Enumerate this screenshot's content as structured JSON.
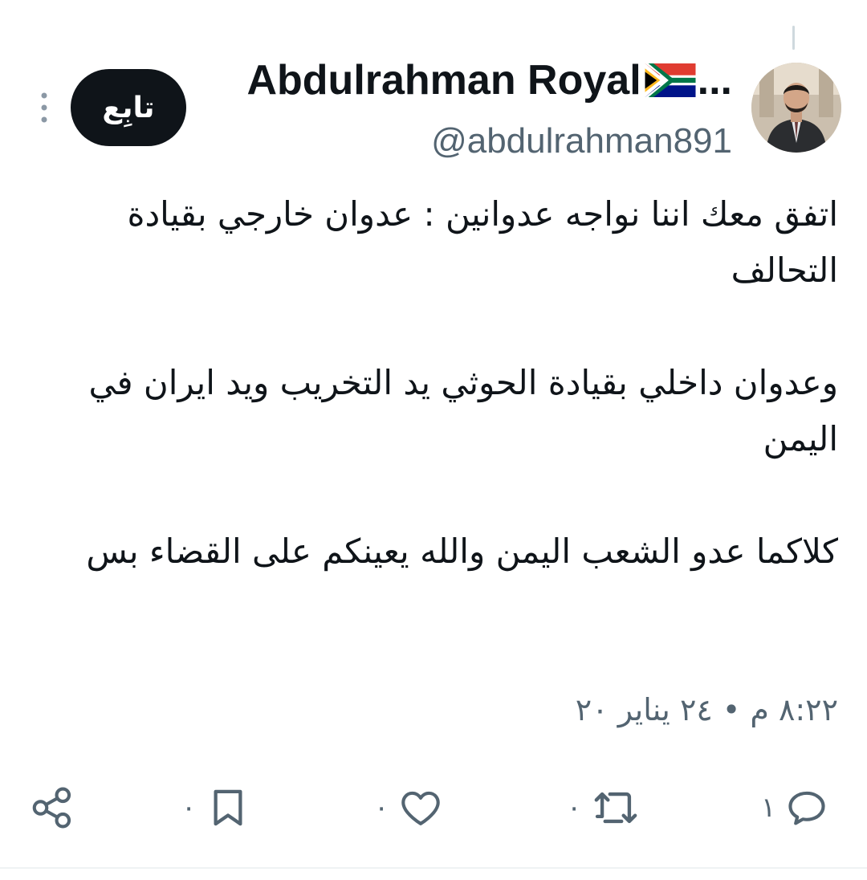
{
  "author": {
    "display_name": "Abdulrahman Royal",
    "name_suffix": "...",
    "handle": "@abdulrahman891"
  },
  "follow_button": {
    "label": "تابِع"
  },
  "tweet": {
    "paragraphs": [
      "اتفق معك اننا نواجه عدوانين : عدوان خارجي بقيادة التحالف",
      "وعدوان داخلي بقيادة الحوثي يد التخريب ويد ايران في اليمن",
      "كلاكما عدو الشعب اليمن والله يعينكم على القضاء بس"
    ],
    "timestamp": "٨:٢٢ م • ٢٤ يناير ٢٠"
  },
  "actions": {
    "reply_count": "١",
    "retweet_count": "٠",
    "like_count": "٠",
    "bookmark_count": "٠"
  },
  "icons": {
    "flag": "south-africa-flag-icon",
    "more": "more-vertical-icon",
    "reply": "reply-icon",
    "retweet": "retweet-icon",
    "like": "heart-icon",
    "bookmark": "bookmark-icon",
    "share": "share-icon"
  },
  "colors": {
    "text_primary": "#0f1419",
    "text_secondary": "#536471",
    "button_bg": "#0f1419",
    "button_text": "#ffffff"
  }
}
